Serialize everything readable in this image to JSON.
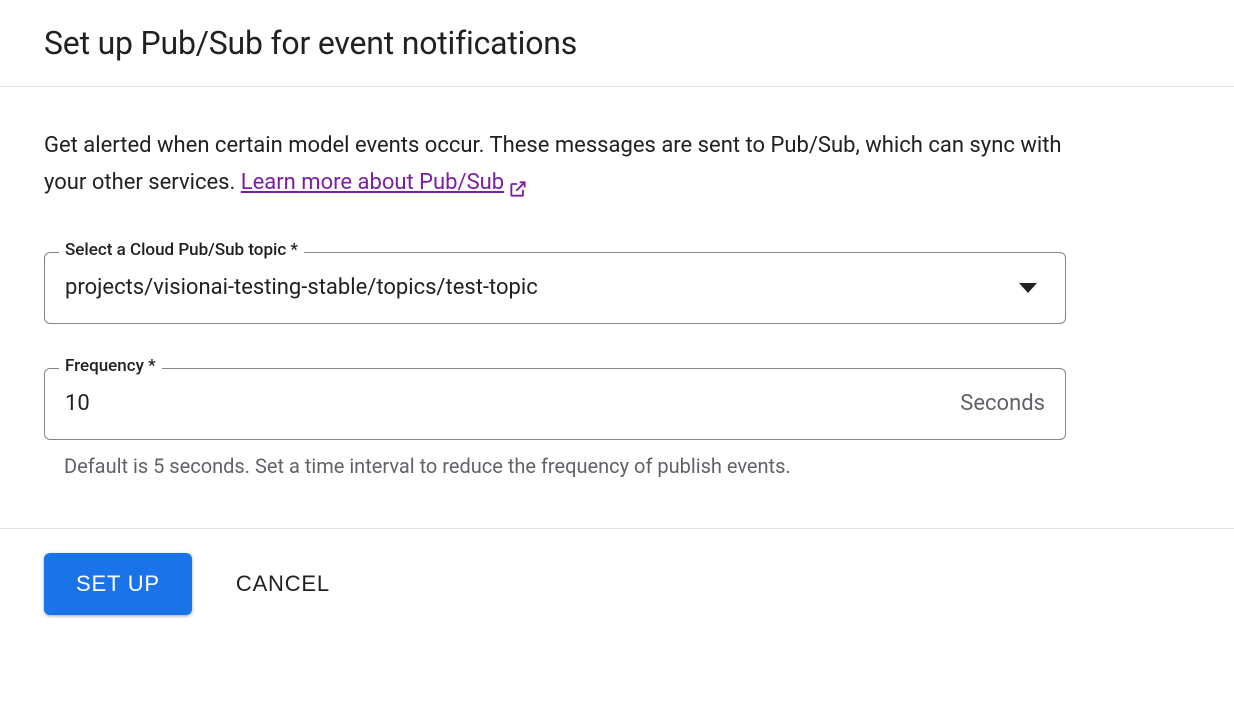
{
  "header": {
    "title": "Set up Pub/Sub for event notifications"
  },
  "content": {
    "description_part1": "Get alerted when certain model events occur. These messages are sent to Pub/Sub, which can sync with your other services. ",
    "learn_more_label": "Learn more about Pub/Sub"
  },
  "form": {
    "topic": {
      "label": "Select a Cloud Pub/Sub topic *",
      "value": "projects/visionai-testing-stable/topics/test-topic"
    },
    "frequency": {
      "label": "Frequency *",
      "value": "10",
      "suffix": "Seconds",
      "helper": "Default is 5 seconds. Set a time interval to reduce the frequency of publish events."
    }
  },
  "footer": {
    "setup_label": "SET UP",
    "cancel_label": "CANCEL"
  }
}
